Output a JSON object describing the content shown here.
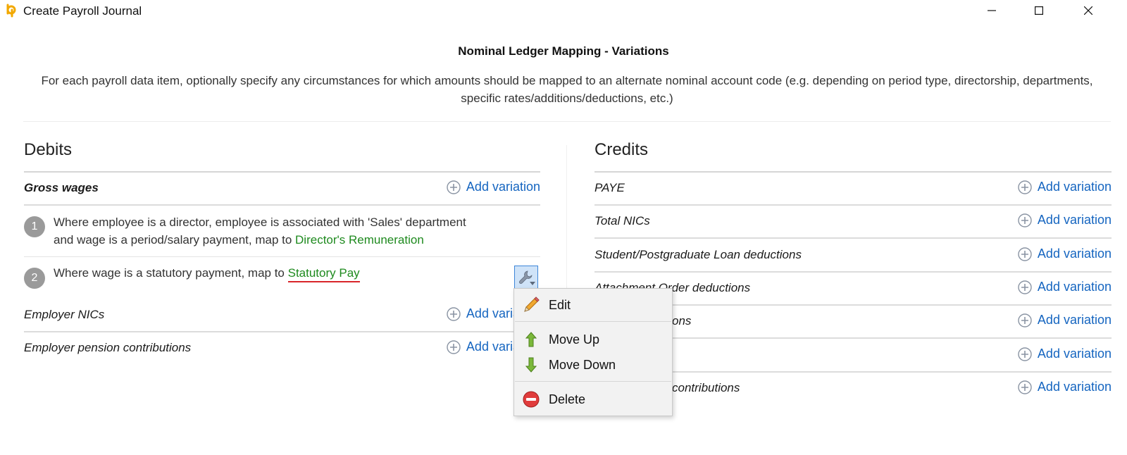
{
  "window": {
    "title": "Create Payroll Journal",
    "logo_icon": "brightpay-logo-icon",
    "controls": [
      "minimize-icon",
      "maximize-icon",
      "close-icon"
    ]
  },
  "header": {
    "title": "Nominal Ledger Mapping - Variations",
    "description": "For each payroll data item, optionally specify any circumstances for which amounts should be mapped to an alternate nominal account code (e.g. depending on period type, directorship, departments, specific rates/additions/deductions, etc.)"
  },
  "add_variation_label": "Add variation",
  "debits": {
    "title": "Debits",
    "gross_wages": {
      "label": "Gross wages",
      "variations": [
        {
          "number": "1",
          "line1": "Where employee is a director, employee is associated with 'Sales' department",
          "line2_prefix": "and wage is a period/salary payment, map to ",
          "account": "Director's Remuneration"
        },
        {
          "number": "2",
          "prefix": "Where wage is a statutory payment, map to ",
          "account": "Statutory Pay"
        }
      ]
    },
    "items": [
      {
        "label": "Employer NICs"
      },
      {
        "label": "Employer pension contributions"
      }
    ]
  },
  "credits": {
    "title": "Credits",
    "items": [
      {
        "label": "PAYE"
      },
      {
        "label": "Total NICs"
      },
      {
        "label": "Student/Postgraduate Loan deductions"
      },
      {
        "label": "Attachment Order deductions"
      },
      {
        "label": "ons"
      },
      {
        "label": ""
      },
      {
        "label": "contributions"
      }
    ]
  },
  "context_menu": {
    "items": [
      {
        "label": "Edit",
        "icon": "pencil-icon"
      },
      {
        "label": "Move Up",
        "icon": "arrow-up-icon"
      },
      {
        "label": "Move Down",
        "icon": "arrow-down-icon"
      },
      {
        "label": "Delete",
        "icon": "delete-icon"
      }
    ]
  },
  "colors": {
    "link": "#1565c0",
    "account": "#1e8a1e",
    "spellcheck": "#d9252a",
    "selected_button": "#cfe3f8"
  }
}
